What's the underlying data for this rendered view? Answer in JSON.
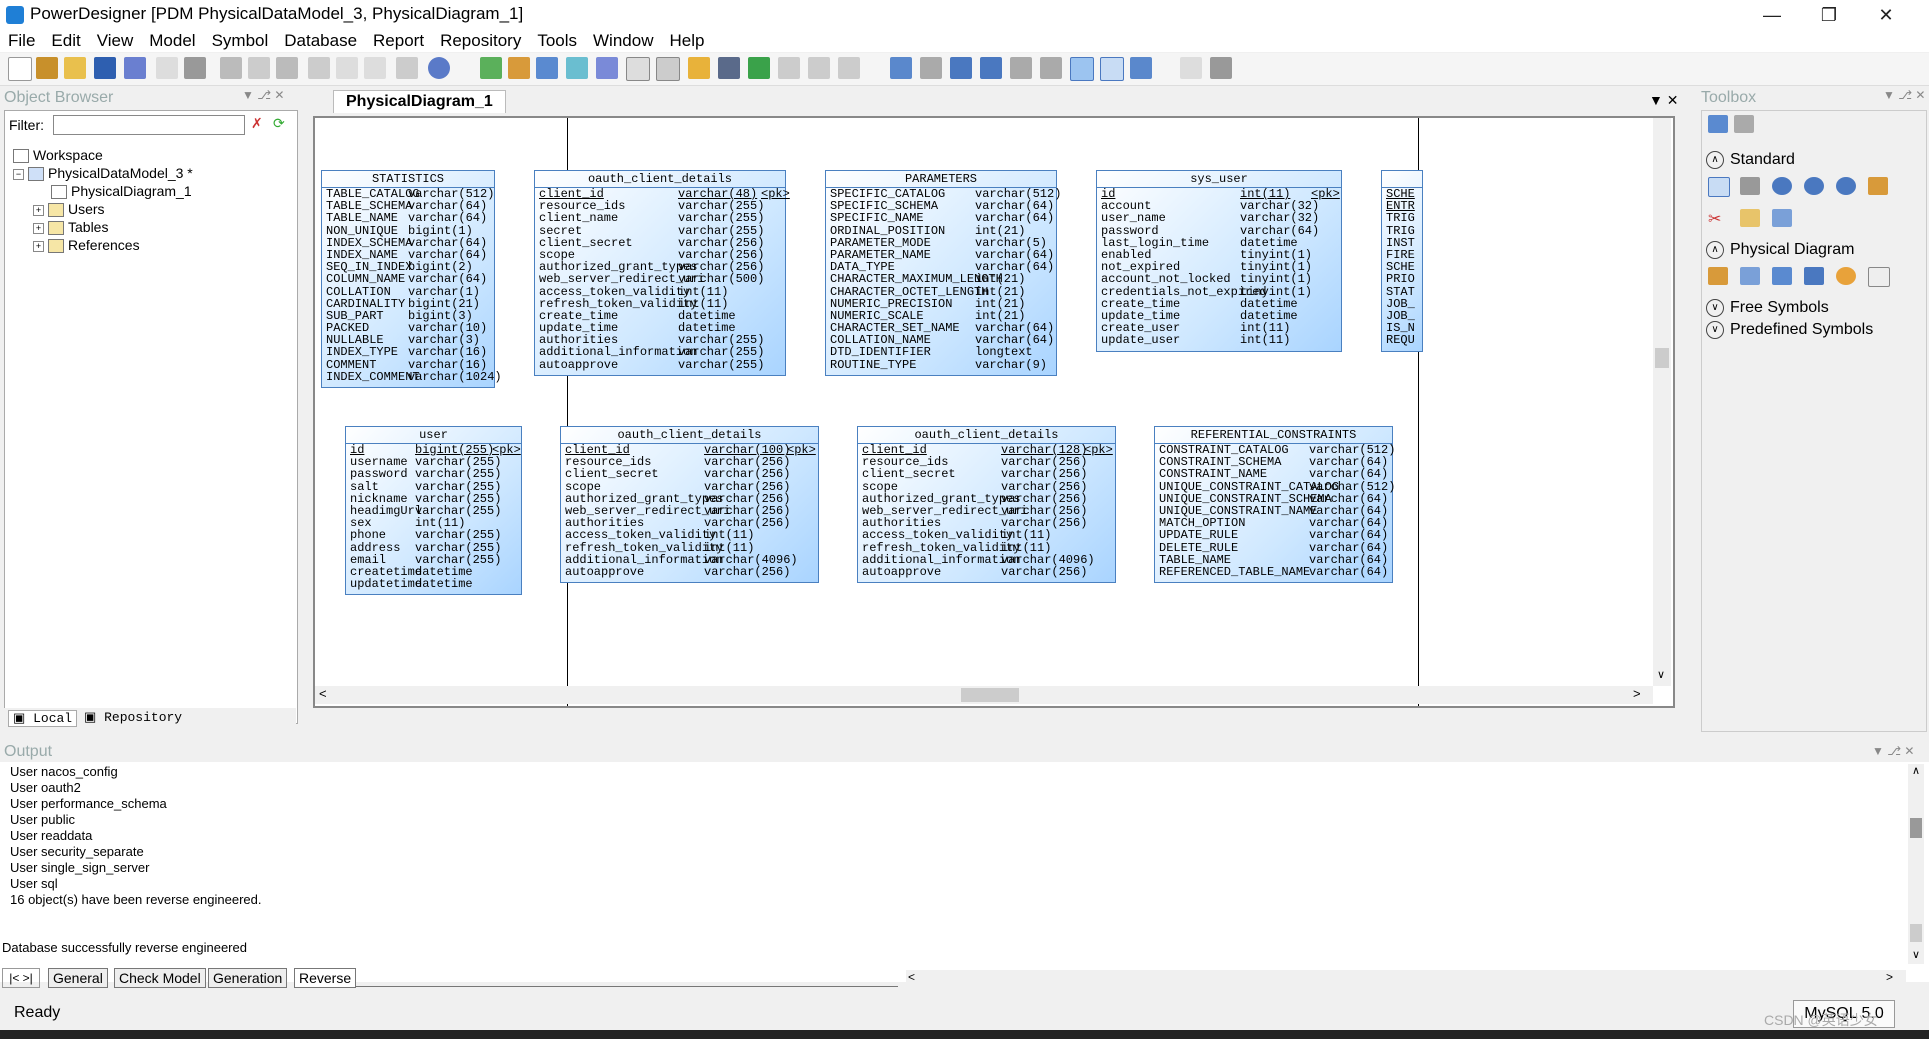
{
  "window": {
    "title": "PowerDesigner [PDM PhysicalDataModel_3, PhysicalDiagram_1]"
  },
  "menu": [
    {
      "label": "File"
    },
    {
      "label": "Edit"
    },
    {
      "label": "View"
    },
    {
      "label": "Model"
    },
    {
      "label": "Symbol"
    },
    {
      "label": "Database"
    },
    {
      "label": "Report"
    },
    {
      "label": "Repository"
    },
    {
      "label": "Tools"
    },
    {
      "label": "Window"
    },
    {
      "label": "Help"
    }
  ],
  "object_browser": {
    "title": "Object Browser",
    "filter_label": "Filter:",
    "tree": {
      "workspace": "Workspace",
      "model": "PhysicalDataModel_3 *",
      "diagram": "PhysicalDiagram_1",
      "users": "Users",
      "tables": "Tables",
      "references": "References"
    },
    "tabs": {
      "local": "Local",
      "repository": "Repository"
    }
  },
  "diagram": {
    "tab": "PhysicalDiagram_1",
    "entities": [
      {
        "title": "STATISTICS",
        "cols": [
          [
            "TABLE_CATALOG",
            "varchar(512)",
            ""
          ],
          [
            "TABLE_SCHEMA",
            "varchar(64)",
            ""
          ],
          [
            "TABLE_NAME",
            "varchar(64)",
            ""
          ],
          [
            "NON_UNIQUE",
            "bigint(1)",
            ""
          ],
          [
            "INDEX_SCHEMA",
            "varchar(64)",
            ""
          ],
          [
            "INDEX_NAME",
            "varchar(64)",
            ""
          ],
          [
            "SEQ_IN_INDEX",
            "bigint(2)",
            ""
          ],
          [
            "COLUMN_NAME",
            "varchar(64)",
            ""
          ],
          [
            "COLLATION",
            "varchar(1)",
            ""
          ],
          [
            "CARDINALITY",
            "bigint(21)",
            ""
          ],
          [
            "SUB_PART",
            "bigint(3)",
            ""
          ],
          [
            "PACKED",
            "varchar(10)",
            ""
          ],
          [
            "NULLABLE",
            "varchar(3)",
            ""
          ],
          [
            "INDEX_TYPE",
            "varchar(16)",
            ""
          ],
          [
            "COMMENT",
            "varchar(16)",
            ""
          ],
          [
            "INDEX_COMMENT",
            "varchar(1024)",
            ""
          ]
        ]
      },
      {
        "title": "oauth_client_details",
        "cols": [
          [
            "client_id",
            "varchar(48)",
            "<pk>"
          ],
          [
            "resource_ids",
            "varchar(255)",
            ""
          ],
          [
            "client_name",
            "varchar(255)",
            ""
          ],
          [
            "secret",
            "varchar(255)",
            ""
          ],
          [
            "client_secret",
            "varchar(256)",
            ""
          ],
          [
            "scope",
            "varchar(256)",
            ""
          ],
          [
            "authorized_grant_types",
            "varchar(256)",
            ""
          ],
          [
            "web_server_redirect_uri",
            "varchar(500)",
            ""
          ],
          [
            "access_token_validity",
            "int(11)",
            ""
          ],
          [
            "refresh_token_validity",
            "int(11)",
            ""
          ],
          [
            "create_time",
            "datetime",
            ""
          ],
          [
            "update_time",
            "datetime",
            ""
          ],
          [
            "authorities",
            "varchar(255)",
            ""
          ],
          [
            "additional_information",
            "varchar(255)",
            ""
          ],
          [
            "autoapprove",
            "varchar(255)",
            ""
          ]
        ]
      },
      {
        "title": "PARAMETERS",
        "cols": [
          [
            "SPECIFIC_CATALOG",
            "varchar(512)",
            ""
          ],
          [
            "SPECIFIC_SCHEMA",
            "varchar(64)",
            ""
          ],
          [
            "SPECIFIC_NAME",
            "varchar(64)",
            ""
          ],
          [
            "ORDINAL_POSITION",
            "int(21)",
            ""
          ],
          [
            "PARAMETER_MODE",
            "varchar(5)",
            ""
          ],
          [
            "PARAMETER_NAME",
            "varchar(64)",
            ""
          ],
          [
            "DATA_TYPE",
            "varchar(64)",
            ""
          ],
          [
            "CHARACTER_MAXIMUM_LENGTH",
            "int(21)",
            ""
          ],
          [
            "CHARACTER_OCTET_LENGTH",
            "int(21)",
            ""
          ],
          [
            "NUMERIC_PRECISION",
            "int(21)",
            ""
          ],
          [
            "NUMERIC_SCALE",
            "int(21)",
            ""
          ],
          [
            "CHARACTER_SET_NAME",
            "varchar(64)",
            ""
          ],
          [
            "COLLATION_NAME",
            "varchar(64)",
            ""
          ],
          [
            "DTD_IDENTIFIER",
            "longtext",
            ""
          ],
          [
            "ROUTINE_TYPE",
            "varchar(9)",
            ""
          ]
        ]
      },
      {
        "title": "sys_user",
        "cols": [
          [
            "id",
            "int(11)",
            "<pk>"
          ],
          [
            "account",
            "varchar(32)",
            ""
          ],
          [
            "user_name",
            "varchar(32)",
            ""
          ],
          [
            "password",
            "varchar(64)",
            ""
          ],
          [
            "last_login_time",
            "datetime",
            ""
          ],
          [
            "enabled",
            "tinyint(1)",
            ""
          ],
          [
            "not_expired",
            "tinyint(1)",
            ""
          ],
          [
            "account_not_locked",
            "tinyint(1)",
            ""
          ],
          [
            "credentials_not_expired",
            "tinyint(1)",
            ""
          ],
          [
            "create_time",
            "datetime",
            ""
          ],
          [
            "update_time",
            "datetime",
            ""
          ],
          [
            "create_user",
            "int(11)",
            ""
          ],
          [
            "update_user",
            "int(11)",
            ""
          ]
        ]
      },
      {
        "title": "",
        "cols": [
          [
            "SCHE",
            "",
            ""
          ],
          [
            "ENTR",
            "",
            ""
          ],
          [
            "TRIG",
            "",
            ""
          ],
          [
            "TRIG",
            "",
            ""
          ],
          [
            "INST",
            "",
            ""
          ],
          [
            "FIRE",
            "",
            ""
          ],
          [
            "SCHE",
            "",
            ""
          ],
          [
            "PRIO",
            "",
            ""
          ],
          [
            "STAT",
            "",
            ""
          ],
          [
            "JOB_",
            "",
            ""
          ],
          [
            "JOB_",
            "",
            ""
          ],
          [
            "IS_N",
            "",
            ""
          ],
          [
            "REQU",
            "",
            ""
          ]
        ]
      },
      {
        "title": "user",
        "cols": [
          [
            "id",
            "bigint(255)",
            "<pk>"
          ],
          [
            "username",
            "varchar(255)",
            ""
          ],
          [
            "password",
            "varchar(255)",
            ""
          ],
          [
            "salt",
            "varchar(255)",
            ""
          ],
          [
            "nickname",
            "varchar(255)",
            ""
          ],
          [
            "headimgUrl",
            "varchar(255)",
            ""
          ],
          [
            "sex",
            "int(11)",
            ""
          ],
          [
            "phone",
            "varchar(255)",
            ""
          ],
          [
            "address",
            "varchar(255)",
            ""
          ],
          [
            "email",
            "varchar(255)",
            ""
          ],
          [
            "createtime",
            "datetime",
            ""
          ],
          [
            "updatetime",
            "datetime",
            ""
          ]
        ]
      },
      {
        "title": "oauth_client_details",
        "cols": [
          [
            "client_id",
            "varchar(100)",
            "<pk>"
          ],
          [
            "resource_ids",
            "varchar(256)",
            ""
          ],
          [
            "client_secret",
            "varchar(256)",
            ""
          ],
          [
            "scope",
            "varchar(256)",
            ""
          ],
          [
            "authorized_grant_types",
            "varchar(256)",
            ""
          ],
          [
            "web_server_redirect_uri",
            "varchar(256)",
            ""
          ],
          [
            "authorities",
            "varchar(256)",
            ""
          ],
          [
            "access_token_validity",
            "int(11)",
            ""
          ],
          [
            "refresh_token_validity",
            "int(11)",
            ""
          ],
          [
            "additional_information",
            "varchar(4096)",
            ""
          ],
          [
            "autoapprove",
            "varchar(256)",
            ""
          ]
        ]
      },
      {
        "title": "oauth_client_details",
        "cols": [
          [
            "client_id",
            "varchar(128)",
            "<pk>"
          ],
          [
            "resource_ids",
            "varchar(256)",
            ""
          ],
          [
            "client_secret",
            "varchar(256)",
            ""
          ],
          [
            "scope",
            "varchar(256)",
            ""
          ],
          [
            "authorized_grant_types",
            "varchar(256)",
            ""
          ],
          [
            "web_server_redirect_uri",
            "varchar(256)",
            ""
          ],
          [
            "authorities",
            "varchar(256)",
            ""
          ],
          [
            "access_token_validity",
            "int(11)",
            ""
          ],
          [
            "refresh_token_validity",
            "int(11)",
            ""
          ],
          [
            "additional_information",
            "varchar(4096)",
            ""
          ],
          [
            "autoapprove",
            "varchar(256)",
            ""
          ]
        ]
      },
      {
        "title": "REFERENTIAL_CONSTRAINTS",
        "cols": [
          [
            "CONSTRAINT_CATALOG",
            "varchar(512)",
            ""
          ],
          [
            "CONSTRAINT_SCHEMA",
            "varchar(64)",
            ""
          ],
          [
            "CONSTRAINT_NAME",
            "varchar(64)",
            ""
          ],
          [
            "UNIQUE_CONSTRAINT_CATALOG",
            "varchar(512)",
            ""
          ],
          [
            "UNIQUE_CONSTRAINT_SCHEMA",
            "varchar(64)",
            ""
          ],
          [
            "UNIQUE_CONSTRAINT_NAME",
            "varchar(64)",
            ""
          ],
          [
            "MATCH_OPTION",
            "varchar(64)",
            ""
          ],
          [
            "UPDATE_RULE",
            "varchar(64)",
            ""
          ],
          [
            "DELETE_RULE",
            "varchar(64)",
            ""
          ],
          [
            "TABLE_NAME",
            "varchar(64)",
            ""
          ],
          [
            "REFERENCED_TABLE_NAME",
            "varchar(64)",
            ""
          ]
        ]
      }
    ]
  },
  "toolbox": {
    "title": "Toolbox",
    "sections": [
      "Standard",
      "Physical Diagram",
      "Free Symbols",
      "Predefined Symbols"
    ]
  },
  "output": {
    "title": "Output",
    "lines": [
      "User nacos_config",
      "User oauth2",
      "User performance_schema",
      "User public",
      "User readdata",
      "User security_separate",
      "User single_sign_server",
      "User sql",
      "16 object(s) have been reverse engineered.",
      "",
      "Database successfully reverse engineered"
    ],
    "tabs": [
      "General",
      "Check Model",
      "Generation",
      "Reverse"
    ]
  },
  "status": {
    "text": "Ready",
    "db": "MySQL 5.0"
  },
  "watermark": "CSDN @英语少女"
}
